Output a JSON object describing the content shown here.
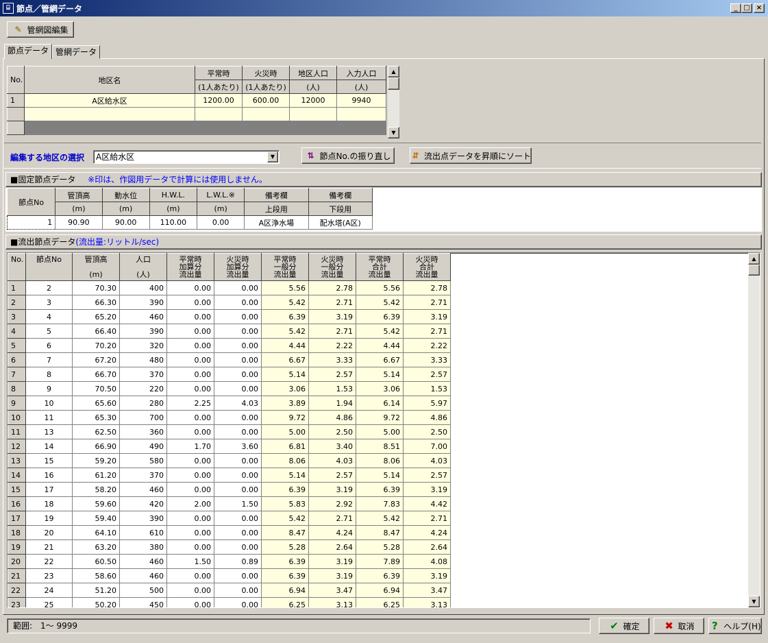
{
  "window": {
    "icon": "network-icon",
    "title": "節点／管網データ",
    "min": "_",
    "max": "□",
    "close": "×"
  },
  "toolbar": {
    "edit_pipe_map": "管網図編集"
  },
  "tabs": {
    "node": "節点データ",
    "pipe": "管網データ"
  },
  "district_table": {
    "headers": [
      {
        "top": "No.",
        "bottom": ""
      },
      {
        "top": "地区名",
        "bottom": ""
      },
      {
        "top": "平常時",
        "bottom": "(1人あたり)"
      },
      {
        "top": "火災時",
        "bottom": "(1人あたり)"
      },
      {
        "top": "地区人口",
        "bottom": "(人)"
      },
      {
        "top": "入力人口",
        "bottom": "(人)"
      }
    ],
    "rows": [
      {
        "no": "1",
        "name": "A区給水区",
        "normal": "1200.00",
        "fire": "600.00",
        "population": "12000",
        "input_population": "9940"
      }
    ]
  },
  "district_select": {
    "label": "編集する地区の選択",
    "value": "A区給水区",
    "renumber_button": "節点No.の振り直し",
    "sort_button": "流出点データを昇順にソート"
  },
  "fixed_node": {
    "title": "■固定節点データ",
    "note": "※印は、作図用データで計算には使用しません。",
    "headers": [
      {
        "top": "節点No",
        "bottom": ""
      },
      {
        "top": "管頂高",
        "bottom": "(m)"
      },
      {
        "top": "動水位",
        "bottom": "(m)"
      },
      {
        "top": "H.W.L.",
        "bottom": "(m)"
      },
      {
        "top": "L.W.L.※",
        "bottom": "(m)"
      },
      {
        "top": "備考欄",
        "bottom": "上段用"
      },
      {
        "top": "備考欄",
        "bottom": "下段用"
      }
    ],
    "row": {
      "node_no": "1",
      "pipe_top": "90.90",
      "water_level": "90.00",
      "hwl": "110.00",
      "lwl": "0.00",
      "note_upper": "A区浄水場",
      "note_lower": "配水塔(A区)"
    }
  },
  "outflow": {
    "title": "■流出節点データ",
    "unit_note": "(流出量:リットル/sec)",
    "headers": [
      {
        "l1": "No.",
        "l2": "",
        "l3": ""
      },
      {
        "l1": "節点No",
        "l2": "",
        "l3": ""
      },
      {
        "l1": "管頂高",
        "l2": "",
        "l3": "(m)"
      },
      {
        "l1": "人口",
        "l2": "",
        "l3": "(人)"
      },
      {
        "l1": "平常時",
        "l2": "加算分",
        "l3": "流出量"
      },
      {
        "l1": "火災時",
        "l2": "加算分",
        "l3": "流出量"
      },
      {
        "l1": "平常時",
        "l2": "一般分",
        "l3": "流出量"
      },
      {
        "l1": "火災時",
        "l2": "一般分",
        "l3": "流出量"
      },
      {
        "l1": "平常時",
        "l2": "合計",
        "l3": "流出量"
      },
      {
        "l1": "火災時",
        "l2": "合計",
        "l3": "流出量"
      }
    ],
    "rows": [
      [
        "1",
        "2",
        "70.30",
        "400",
        "0.00",
        "0.00",
        "5.56",
        "2.78",
        "5.56",
        "2.78"
      ],
      [
        "2",
        "3",
        "66.30",
        "390",
        "0.00",
        "0.00",
        "5.42",
        "2.71",
        "5.42",
        "2.71"
      ],
      [
        "3",
        "4",
        "65.20",
        "460",
        "0.00",
        "0.00",
        "6.39",
        "3.19",
        "6.39",
        "3.19"
      ],
      [
        "4",
        "5",
        "66.40",
        "390",
        "0.00",
        "0.00",
        "5.42",
        "2.71",
        "5.42",
        "2.71"
      ],
      [
        "5",
        "6",
        "70.20",
        "320",
        "0.00",
        "0.00",
        "4.44",
        "2.22",
        "4.44",
        "2.22"
      ],
      [
        "6",
        "7",
        "67.20",
        "480",
        "0.00",
        "0.00",
        "6.67",
        "3.33",
        "6.67",
        "3.33"
      ],
      [
        "7",
        "8",
        "66.70",
        "370",
        "0.00",
        "0.00",
        "5.14",
        "2.57",
        "5.14",
        "2.57"
      ],
      [
        "8",
        "9",
        "70.50",
        "220",
        "0.00",
        "0.00",
        "3.06",
        "1.53",
        "3.06",
        "1.53"
      ],
      [
        "9",
        "10",
        "65.60",
        "280",
        "2.25",
        "4.03",
        "3.89",
        "1.94",
        "6.14",
        "5.97"
      ],
      [
        "10",
        "11",
        "65.30",
        "700",
        "0.00",
        "0.00",
        "9.72",
        "4.86",
        "9.72",
        "4.86"
      ],
      [
        "11",
        "13",
        "62.50",
        "360",
        "0.00",
        "0.00",
        "5.00",
        "2.50",
        "5.00",
        "2.50"
      ],
      [
        "12",
        "14",
        "66.90",
        "490",
        "1.70",
        "3.60",
        "6.81",
        "3.40",
        "8.51",
        "7.00"
      ],
      [
        "13",
        "15",
        "59.20",
        "580",
        "0.00",
        "0.00",
        "8.06",
        "4.03",
        "8.06",
        "4.03"
      ],
      [
        "14",
        "16",
        "61.20",
        "370",
        "0.00",
        "0.00",
        "5.14",
        "2.57",
        "5.14",
        "2.57"
      ],
      [
        "15",
        "17",
        "58.20",
        "460",
        "0.00",
        "0.00",
        "6.39",
        "3.19",
        "6.39",
        "3.19"
      ],
      [
        "16",
        "18",
        "59.60",
        "420",
        "2.00",
        "1.50",
        "5.83",
        "2.92",
        "7.83",
        "4.42"
      ],
      [
        "17",
        "19",
        "59.40",
        "390",
        "0.00",
        "0.00",
        "5.42",
        "2.71",
        "5.42",
        "2.71"
      ],
      [
        "18",
        "20",
        "64.10",
        "610",
        "0.00",
        "0.00",
        "8.47",
        "4.24",
        "8.47",
        "4.24"
      ],
      [
        "19",
        "21",
        "63.20",
        "380",
        "0.00",
        "0.00",
        "5.28",
        "2.64",
        "5.28",
        "2.64"
      ],
      [
        "20",
        "22",
        "60.50",
        "460",
        "1.50",
        "0.89",
        "6.39",
        "3.19",
        "7.89",
        "4.08"
      ],
      [
        "21",
        "23",
        "58.60",
        "460",
        "0.00",
        "0.00",
        "6.39",
        "3.19",
        "6.39",
        "3.19"
      ],
      [
        "22",
        "24",
        "51.20",
        "500",
        "0.00",
        "0.00",
        "6.94",
        "3.47",
        "6.94",
        "3.47"
      ],
      [
        "23",
        "25",
        "50.20",
        "450",
        "0.00",
        "0.00",
        "6.25",
        "3.13",
        "6.25",
        "3.13"
      ]
    ]
  },
  "status": {
    "range": "範囲:　1～ 9999"
  },
  "footer": {
    "ok": "確定",
    "cancel": "取消",
    "help": "ヘルプ(H)"
  }
}
